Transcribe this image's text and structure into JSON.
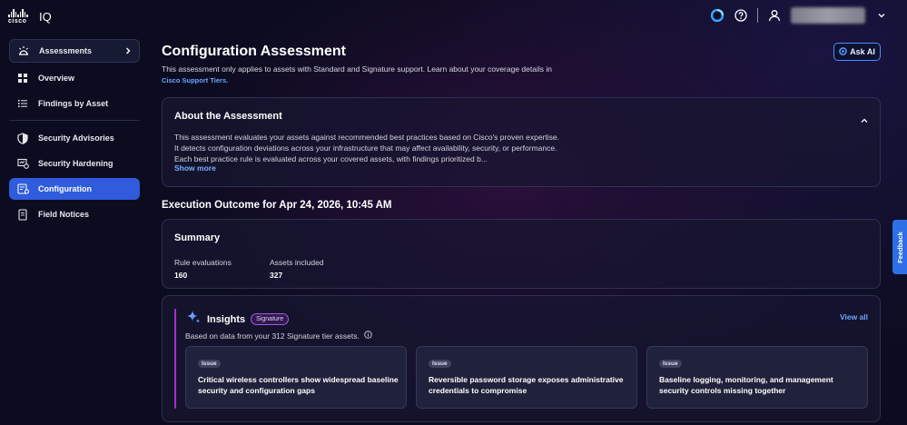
{
  "brand": {
    "logo_word": "cisco",
    "product": "IQ"
  },
  "topbar": {
    "icons": [
      "webex-icon",
      "help-icon",
      "user-icon",
      "chevron-down-icon"
    ]
  },
  "sidebar": {
    "group_label": "Assessments",
    "items": [
      {
        "label": "Overview",
        "icon": "overview-icon"
      },
      {
        "label": "Findings by Asset",
        "icon": "list-icon"
      },
      {
        "label": "Security Advisories",
        "icon": "shield-icon"
      },
      {
        "label": "Security Hardening",
        "icon": "hardening-icon"
      },
      {
        "label": "Configuration",
        "icon": "configuration-icon",
        "active": true
      },
      {
        "label": "Field Notices",
        "icon": "field-notice-icon"
      }
    ]
  },
  "header": {
    "title": "Configuration Assessment",
    "ask_ai": "Ask AI",
    "intro_text": "This assessment only applies to assets with Standard and Signature support. Learn about your coverage details in",
    "intro_link": "Cisco Support Tiers."
  },
  "about": {
    "title": "About the Assessment",
    "body": "This assessment evaluates your assets against recommended best practices based on Cisco's proven expertise. It detects configuration deviations across your infrastructure that may affect availability, security, or performance. Each best practice rule is evaluated across your covered assets, with findings prioritized b...",
    "show_more": "Show more"
  },
  "execution": {
    "title": "Execution Outcome for Apr 24, 2026, 10:45 AM"
  },
  "summary": {
    "title": "Summary",
    "metrics": [
      {
        "label": "Rule evaluations",
        "value": "160"
      },
      {
        "label": "Assets included",
        "value": "327"
      }
    ]
  },
  "insights": {
    "title": "Insights",
    "badge": "Signature",
    "view_all": "View all",
    "subtitle": "Based on data from your 312 Signature tier assets.",
    "cards": [
      {
        "badge": "Issue",
        "text": "Critical wireless controllers show widespread baseline security and configuration gaps"
      },
      {
        "badge": "Issue",
        "text": "Reversible password storage exposes administrative credentials to compromise"
      },
      {
        "badge": "Issue",
        "text": "Baseline logging, monitoring, and management security controls missing together"
      }
    ]
  },
  "feedback": {
    "label": "Feedback"
  },
  "colors": {
    "accent": "#2f5bdc",
    "link": "#6ea4ff",
    "insight_bar": "#a52fd1",
    "background": "#0b0c1f"
  }
}
